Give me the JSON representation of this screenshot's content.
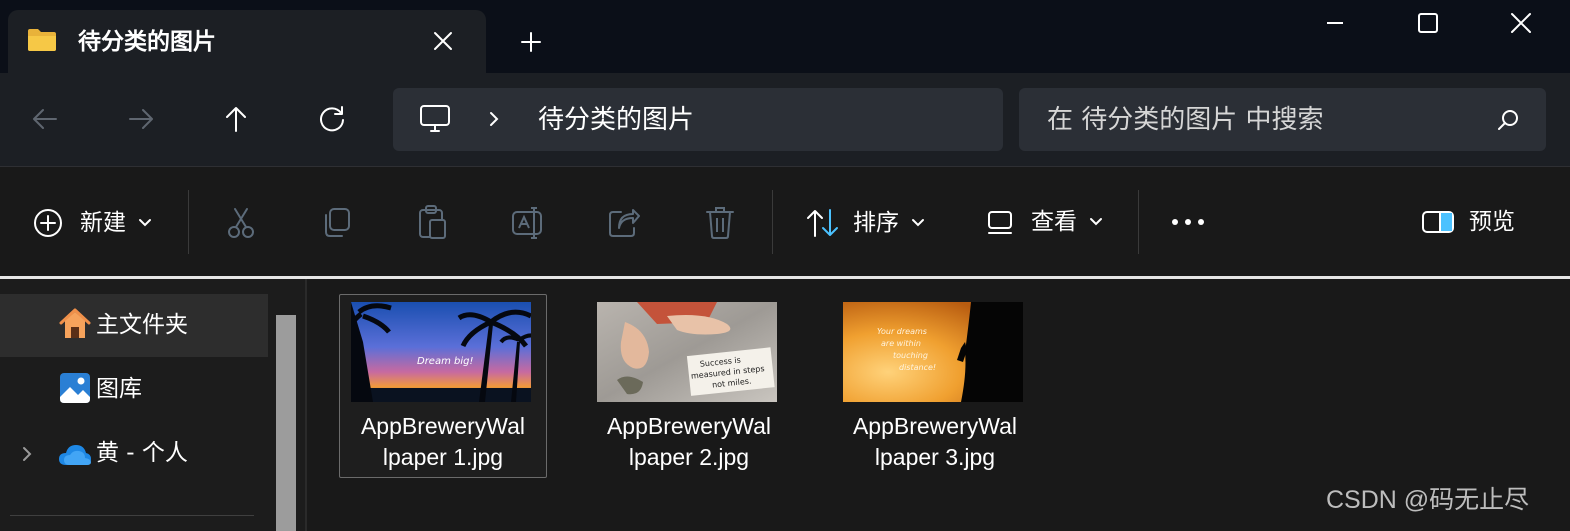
{
  "colors": {
    "titlebar_bg": "#0b0f18",
    "tab_bg": "#1c1f24",
    "field_bg": "#2b2f36",
    "body_bg": "#191919",
    "folder_yellow": "#f6c846",
    "accent_blue": "#4cc2ff",
    "disabled_icon": "#6b7a8a"
  },
  "tab": {
    "title": "待分类的图片",
    "folder_icon": "folder-icon",
    "close_icon": "close-icon"
  },
  "titlebar": {
    "new_tab_icon": "plus-icon",
    "minimize_icon": "minimize-icon",
    "maximize_icon": "maximize-icon",
    "close_icon": "close-icon"
  },
  "nav": {
    "back_icon": "arrow-left-icon",
    "forward_icon": "arrow-right-icon",
    "up_icon": "arrow-up-icon",
    "refresh_icon": "refresh-icon",
    "address": {
      "location_icon": "this-pc-icon",
      "path": "待分类的图片"
    },
    "search": {
      "placeholder": "在 待分类的图片 中搜索"
    }
  },
  "commands": {
    "new_label": "新建",
    "sort_label": "排序",
    "view_label": "查看",
    "preview_label": "预览",
    "disabled_icons": [
      "cut-icon",
      "copy-icon",
      "paste-icon",
      "rename-icon",
      "share-icon",
      "delete-icon"
    ],
    "more_icon": "more-icon"
  },
  "sidebar": {
    "items": [
      {
        "label": "主文件夹",
        "icon": "home-icon",
        "selected": true
      },
      {
        "label": "图库",
        "icon": "gallery-icon",
        "selected": false
      },
      {
        "label": "黄 - 个人",
        "icon": "onedrive-cloud-icon",
        "selected": false,
        "expandable": true
      }
    ]
  },
  "files": [
    {
      "name": "AppBreweryWallpaper 1.jpg",
      "line1": "AppBreweryWal",
      "line2": "lpaper 1.jpg",
      "thumb_text": "Dream big!",
      "selected": true
    },
    {
      "name": "AppBreweryWallpaper 2.jpg",
      "line1": "AppBreweryWal",
      "line2": "lpaper 2.jpg",
      "thumb_text_1": "Success is",
      "thumb_text_2": "measured in steps",
      "thumb_text_3": "not miles.",
      "selected": false
    },
    {
      "name": "AppBreweryWallpaper 3.jpg",
      "line1": "AppBreweryWal",
      "line2": "lpaper 3.jpg",
      "thumb_text_1": "Your dreams",
      "thumb_text_2": "are within",
      "thumb_text_3": "touching",
      "thumb_text_4": "distance!",
      "selected": false
    }
  ],
  "watermark": "CSDN @码无止尽"
}
